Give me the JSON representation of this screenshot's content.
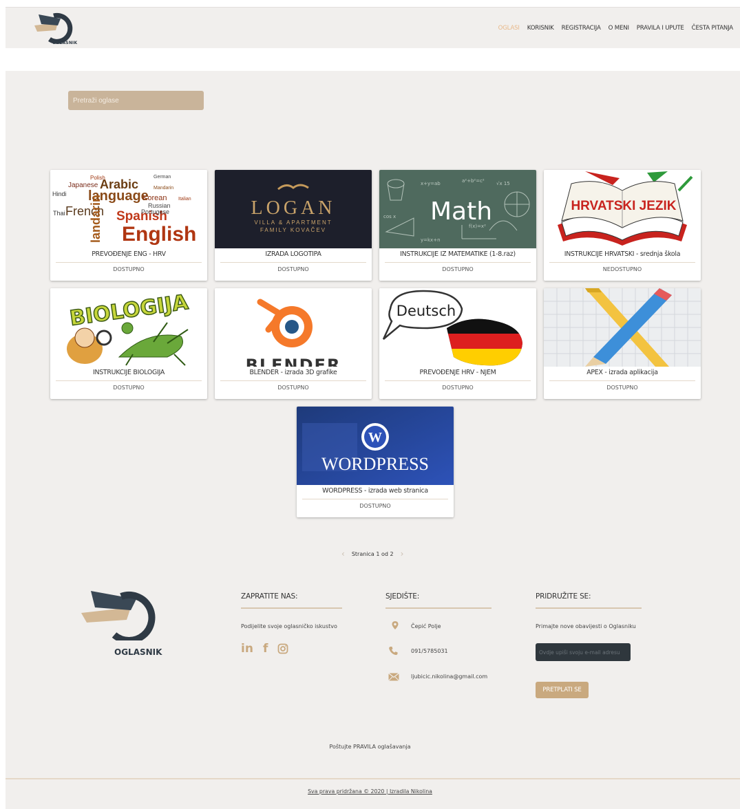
{
  "header": {
    "logo_text": "OGLASNIK",
    "nav": [
      "OGLASI",
      "KORISNIK",
      "REGISTRACIJA",
      "O MENI",
      "PRAVILA I UPUTE",
      "ČESTA PITANJA"
    ]
  },
  "search": {
    "placeholder": "Pretraži oglase"
  },
  "cards": [
    {
      "title": "PREVOĐENJE ENG - HRV",
      "status": "DOSTUPNO",
      "image_text": [
        "Japanese",
        "Arabic",
        "Hindi",
        "language",
        "French",
        "Spanish",
        "English",
        "Polish",
        "Korean",
        "Russian",
        "Portugese",
        "German",
        "Thai",
        "Mandarin",
        "Italian"
      ]
    },
    {
      "title": "IZRADA LOGOTIPA",
      "status": "DOSTUPNO",
      "image_text": [
        "LOGAN",
        "VILLA & APARTMENT",
        "FAMILY KOVAČEV"
      ]
    },
    {
      "title": "INSTRUKCIJE IZ MATEMATIKE (1-8.raz)",
      "status": "DOSTUPNO",
      "image_text": [
        "Math"
      ]
    },
    {
      "title": "INSTRUKCIJE HRVATSKI - srednja škola",
      "status": "NEDOSTUPNO",
      "image_text": [
        "HRVATSKI JEZIK"
      ]
    },
    {
      "title": "INSTRUKCIJE BIOLOGIJA",
      "status": "DOSTUPNO",
      "image_text": [
        "BIOLOGIJA"
      ]
    },
    {
      "title": "BLENDER - izrada 3D grafike",
      "status": "DOSTUPNO",
      "image_text": [
        "BLENDER"
      ]
    },
    {
      "title": "PREVOĐENJE HRV - NJEM",
      "status": "DOSTUPNO",
      "image_text": [
        "Deutsch"
      ]
    },
    {
      "title": "APEX - izrada aplikacija",
      "status": "DOSTUPNO",
      "image_text": []
    },
    {
      "title": "WORDPRESS - izrada web stranica",
      "status": "DOSTUPNO",
      "image_text": [
        "WORDPRESS"
      ]
    }
  ],
  "pager": {
    "text": "Stranica 1 od 2"
  },
  "footer": {
    "logo_text": "OGLASNIK",
    "follow": {
      "heading": "ZAPRATITE NAS:",
      "text": "Podijelite svoje oglasničko iskustvo",
      "icons": [
        "linkedin-icon",
        "facebook-icon",
        "instagram-icon"
      ]
    },
    "hq": {
      "heading": "SJEDIŠTE:",
      "address": "Čepić Polje",
      "phone": "091/5785031",
      "email": "ljubicic.nikolina@gmail.com"
    },
    "join": {
      "heading": "PRIDRUŽITE SE:",
      "text": "Primajte nove obavijesti o Oglasniku",
      "email_placeholder": "Ovdje upiši svoju e-mail adresu",
      "button": "PRETPLATI SE"
    },
    "rules_link": "Poštujte PRAVILA oglašavanja",
    "copyright": "Sva prava pridržana © 2020 | Izradila Nikolina"
  },
  "colors": {
    "accent": "#c9a97f",
    "nav_active": "#e8b889",
    "dark": "#2f3a45",
    "bg": "#f1efed"
  }
}
